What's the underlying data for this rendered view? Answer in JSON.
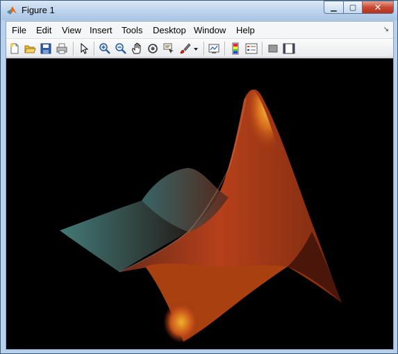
{
  "window": {
    "title": "Figure 1",
    "controls": {
      "minimize": "▁",
      "maximize": "▢",
      "close": "✕"
    }
  },
  "menubar": {
    "items": [
      "File",
      "Edit",
      "View",
      "Insert",
      "Tools",
      "Desktop",
      "Window",
      "Help"
    ],
    "dock_arrow": "↘"
  },
  "toolbar": {
    "icons": [
      "new-figure-icon",
      "open-file-icon",
      "save-figure-icon",
      "print-figure-icon",
      "edit-plot-icon",
      "zoom-in-icon",
      "zoom-out-icon",
      "pan-icon",
      "rotate-3d-icon",
      "data-cursor-icon",
      "brush-icon",
      "brush-dropdown-icon",
      "link-plot-icon",
      "insert-colorbar-icon",
      "insert-legend-icon",
      "hide-plot-tools-icon",
      "show-plot-tools-icon"
    ]
  },
  "figure": {
    "background": "#000000",
    "surface": "MATLAB membrane (L-shaped logo surface)",
    "colors": {
      "peak": "#f4b12a",
      "body": "#c2461a",
      "shadow": "#4a160a",
      "edge": "#5c9c9a"
    }
  }
}
